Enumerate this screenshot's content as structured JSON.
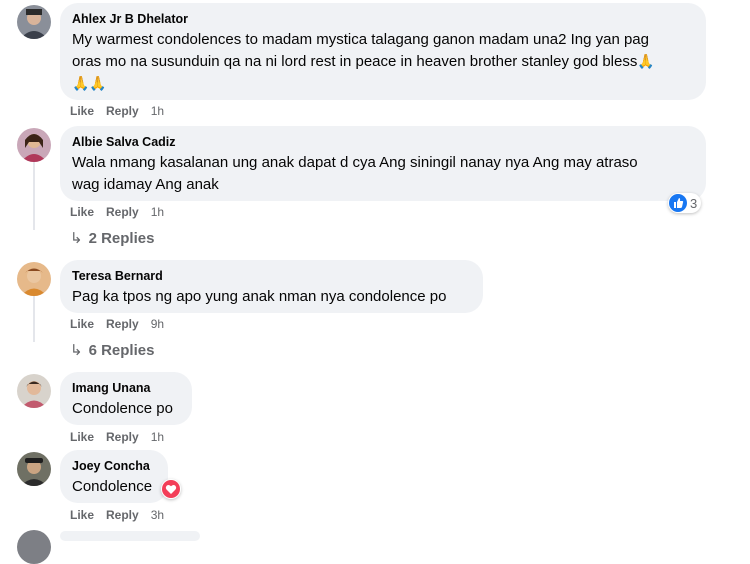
{
  "comments": [
    {
      "author": "Ahlex Jr B Dhelator",
      "line1": "My warmest condolences to madam mystica talagang ganon madam una2 Ing yan pag",
      "line2": "oras mo na susunduin qa na ni lord rest in peace in heaven brother stanley god bless",
      "like": "Like",
      "reply": "Reply",
      "time": "1h"
    },
    {
      "author": "Albie Salva Cadiz",
      "line1": "Wala nmang kasalanan ung anak dapat d cya Ang siningil nanay nya Ang may atraso",
      "line2": "wag idamay Ang anak",
      "like": "Like",
      "reply": "Reply",
      "time": "1h",
      "reaction_count": "3",
      "replies_label": "2 Replies"
    },
    {
      "author": "Teresa Bernard",
      "line1": "Pag ka tpos ng apo yung anak nman nya condolence po",
      "like": "Like",
      "reply": "Reply",
      "time": "9h",
      "replies_label": "6 Replies"
    },
    {
      "author": "Imang Unana",
      "line1": "Condolence po",
      "like": "Like",
      "reply": "Reply",
      "time": "1h"
    },
    {
      "author": "Joey Concha",
      "line1": "Condolence",
      "like": "Like",
      "reply": "Reply",
      "time": "3h"
    }
  ],
  "icons": {
    "pray": "pray-emoji",
    "like_reaction": "like-reaction-icon",
    "heart_reaction": "heart-reaction-icon",
    "reply_arrow": "reply-arrow-icon"
  },
  "colors": {
    "bubble": "#f0f2f5",
    "meta_text": "#65676b",
    "like_blue": "#1877f2",
    "heart_red": "#f33e58"
  }
}
